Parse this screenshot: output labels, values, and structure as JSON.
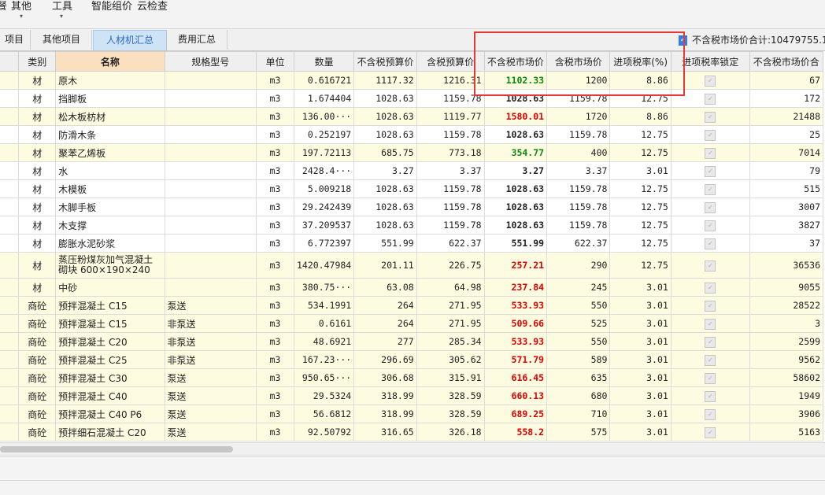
{
  "menu": {
    "items": [
      {
        "label": "其他",
        "caret": "▾"
      },
      {
        "label": "工具",
        "caret": "▾"
      },
      {
        "label": "智能组价"
      },
      {
        "label": "云检查"
      }
    ],
    "partial_left": "餐"
  },
  "tabs": [
    {
      "label": "项目",
      "active": false
    },
    {
      "label": "其他项目",
      "active": false
    },
    {
      "label": "人材机汇总",
      "active": true
    },
    {
      "label": "费用汇总",
      "active": false
    }
  ],
  "summary": {
    "checkbox_icon": "checkbox-checked-icon",
    "label": "不含税市场价合计:10479755.1"
  },
  "columns": [
    "",
    "类别",
    "名称",
    "规格型号",
    "单位",
    "数量",
    "不含税预算价",
    "含税预算价",
    "不含税市场价",
    "含税市场价",
    "进项税率(%)",
    "进项税率锁定",
    "不含税市场价合"
  ],
  "rows": [
    {
      "cat": "材",
      "name": "原木",
      "spec": "",
      "unit": "m3",
      "qty": "0.616721",
      "pre": "1117.32",
      "pretax": "1216.31",
      "mkt": "1102.33",
      "mktc": "green",
      "mkttax": "1200",
      "rate": "8.86",
      "total": "67",
      "bg": "yellow"
    },
    {
      "cat": "材",
      "name": "挡脚板",
      "spec": "",
      "unit": "m3",
      "qty": "1.674404",
      "pre": "1028.63",
      "pretax": "1159.78",
      "mkt": "1028.63",
      "mktc": "",
      "mkttax": "1159.78",
      "rate": "12.75",
      "total": "172",
      "bg": "white"
    },
    {
      "cat": "材",
      "name": "松木板枋材",
      "spec": "",
      "unit": "m3",
      "qty": "136.00···",
      "pre": "1028.63",
      "pretax": "1119.77",
      "mkt": "1580.01",
      "mktc": "red",
      "mkttax": "1720",
      "rate": "8.86",
      "total": "21488",
      "bg": "yellow"
    },
    {
      "cat": "材",
      "name": "防滑木条",
      "spec": "",
      "unit": "m3",
      "qty": "0.252197",
      "pre": "1028.63",
      "pretax": "1159.78",
      "mkt": "1028.63",
      "mktc": "",
      "mkttax": "1159.78",
      "rate": "12.75",
      "total": "25",
      "bg": "white"
    },
    {
      "cat": "材",
      "name": "聚苯乙烯板",
      "spec": "",
      "unit": "m3",
      "qty": "197.72113",
      "pre": "685.75",
      "pretax": "773.18",
      "mkt": "354.77",
      "mktc": "green",
      "mkttax": "400",
      "rate": "12.75",
      "total": "7014",
      "bg": "yellow"
    },
    {
      "cat": "材",
      "name": "水",
      "spec": "",
      "unit": "m3",
      "qty": "2428.4···",
      "pre": "3.27",
      "pretax": "3.37",
      "mkt": "3.27",
      "mktc": "",
      "mkttax": "3.37",
      "rate": "3.01",
      "total": "79",
      "bg": "white"
    },
    {
      "cat": "材",
      "name": "木模板",
      "spec": "",
      "unit": "m3",
      "qty": "5.009218",
      "pre": "1028.63",
      "pretax": "1159.78",
      "mkt": "1028.63",
      "mktc": "",
      "mkttax": "1159.78",
      "rate": "12.75",
      "total": "515",
      "bg": "white"
    },
    {
      "cat": "材",
      "name": "木脚手板",
      "spec": "",
      "unit": "m3",
      "qty": "29.242439",
      "pre": "1028.63",
      "pretax": "1159.78",
      "mkt": "1028.63",
      "mktc": "",
      "mkttax": "1159.78",
      "rate": "12.75",
      "total": "3007",
      "bg": "white"
    },
    {
      "cat": "材",
      "name": "木支撑",
      "spec": "",
      "unit": "m3",
      "qty": "37.209537",
      "pre": "1028.63",
      "pretax": "1159.78",
      "mkt": "1028.63",
      "mktc": "",
      "mkttax": "1159.78",
      "rate": "12.75",
      "total": "3827",
      "bg": "white"
    },
    {
      "cat": "材",
      "name": "膨胀水泥砂浆",
      "spec": "",
      "unit": "m3",
      "qty": "6.772397",
      "pre": "551.99",
      "pretax": "622.37",
      "mkt": "551.99",
      "mktc": "",
      "mkttax": "622.37",
      "rate": "12.75",
      "total": "37",
      "bg": "white"
    },
    {
      "cat": "材",
      "name": "蒸压粉煤灰加气混凝土砌块 600×190×240",
      "spec": "",
      "unit": "m3",
      "qty": "1420.47984",
      "pre": "201.11",
      "pretax": "226.75",
      "mkt": "257.21",
      "mktc": "red",
      "mkttax": "290",
      "rate": "12.75",
      "total": "36536",
      "bg": "yellow",
      "tall": true
    },
    {
      "cat": "材",
      "name": "中砂",
      "spec": "",
      "unit": "m3",
      "qty": "380.75···",
      "pre": "63.08",
      "pretax": "64.98",
      "mkt": "237.84",
      "mktc": "red",
      "mkttax": "245",
      "rate": "3.01",
      "total": "9055",
      "bg": "yellow"
    },
    {
      "cat": "商砼",
      "name": "预拌混凝土 C15",
      "spec": "泵送",
      "unit": "m3",
      "qty": "534.1991",
      "pre": "264",
      "pretax": "271.95",
      "mkt": "533.93",
      "mktc": "red",
      "mkttax": "550",
      "rate": "3.01",
      "total": "28522",
      "bg": "yellow"
    },
    {
      "cat": "商砼",
      "name": "预拌混凝土 C15",
      "spec": "非泵送",
      "unit": "m3",
      "qty": "0.6161",
      "pre": "264",
      "pretax": "271.95",
      "mkt": "509.66",
      "mktc": "red",
      "mkttax": "525",
      "rate": "3.01",
      "total": "3",
      "bg": "yellow"
    },
    {
      "cat": "商砼",
      "name": "预拌混凝土 C20",
      "spec": "非泵送",
      "unit": "m3",
      "qty": "48.6921",
      "pre": "277",
      "pretax": "285.34",
      "mkt": "533.93",
      "mktc": "red",
      "mkttax": "550",
      "rate": "3.01",
      "total": "2599",
      "bg": "yellow"
    },
    {
      "cat": "商砼",
      "name": "预拌混凝土 C25",
      "spec": "非泵送",
      "unit": "m3",
      "qty": "167.23···",
      "pre": "296.69",
      "pretax": "305.62",
      "mkt": "571.79",
      "mktc": "red",
      "mkttax": "589",
      "rate": "3.01",
      "total": "9562",
      "bg": "yellow"
    },
    {
      "cat": "商砼",
      "name": "预拌混凝土 C30",
      "spec": "泵送",
      "unit": "m3",
      "qty": "950.65···",
      "pre": "306.68",
      "pretax": "315.91",
      "mkt": "616.45",
      "mktc": "red",
      "mkttax": "635",
      "rate": "3.01",
      "total": "58602",
      "bg": "yellow"
    },
    {
      "cat": "商砼",
      "name": "预拌混凝土 C40",
      "spec": "泵送",
      "unit": "m3",
      "qty": "29.5324",
      "pre": "318.99",
      "pretax": "328.59",
      "mkt": "660.13",
      "mktc": "red",
      "mkttax": "680",
      "rate": "3.01",
      "total": "1949",
      "bg": "yellow"
    },
    {
      "cat": "商砼",
      "name": "预拌混凝土 C40 P6",
      "spec": "泵送",
      "unit": "m3",
      "qty": "56.6812",
      "pre": "318.99",
      "pretax": "328.59",
      "mkt": "689.25",
      "mktc": "red",
      "mkttax": "710",
      "rate": "3.01",
      "total": "3906",
      "bg": "yellow"
    },
    {
      "cat": "商砼",
      "name": "预拌细石混凝土 C20",
      "spec": "泵送",
      "unit": "m3",
      "qty": "92.50792",
      "pre": "316.65",
      "pretax": "326.18",
      "mkt": "558.2",
      "mktc": "red",
      "mkttax": "575",
      "rate": "3.01",
      "total": "5163",
      "bg": "yellow"
    }
  ],
  "colors": {
    "accent": "#2a6cc0",
    "highlight_box": "#e53935",
    "price_up": "#e00000",
    "price_down": "#0a8a0a",
    "row_yellow": "#fdfbe0"
  }
}
